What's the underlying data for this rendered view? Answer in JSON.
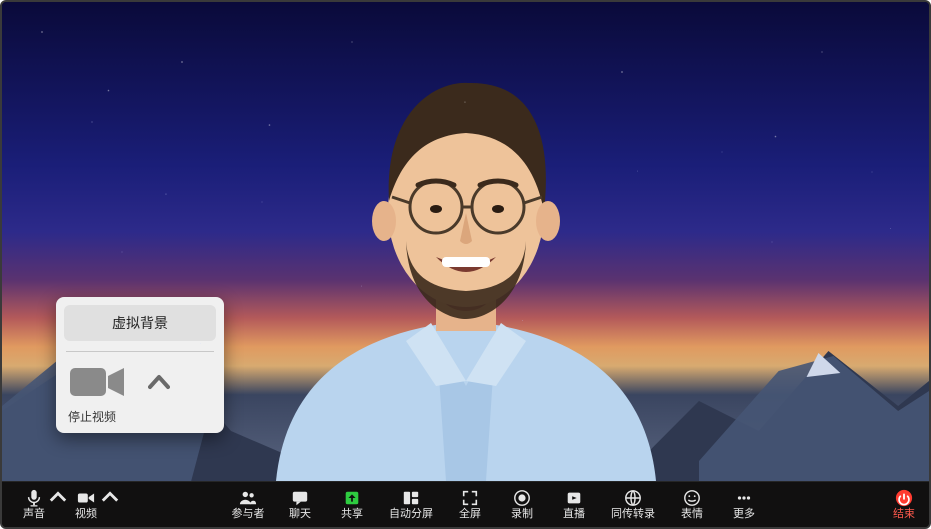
{
  "menu": {
    "virtual_background": "虚拟背景",
    "stop_video": "停止视频"
  },
  "toolbar": {
    "audio": "声音",
    "video": "视频",
    "participants": "参与者",
    "chat": "聊天",
    "share": "共享",
    "auto_split": "自动分屏",
    "fullscreen": "全屏",
    "record": "录制",
    "live": "直播",
    "interpretation": "同传转录",
    "reactions": "表情",
    "more": "更多",
    "end": "结束"
  }
}
